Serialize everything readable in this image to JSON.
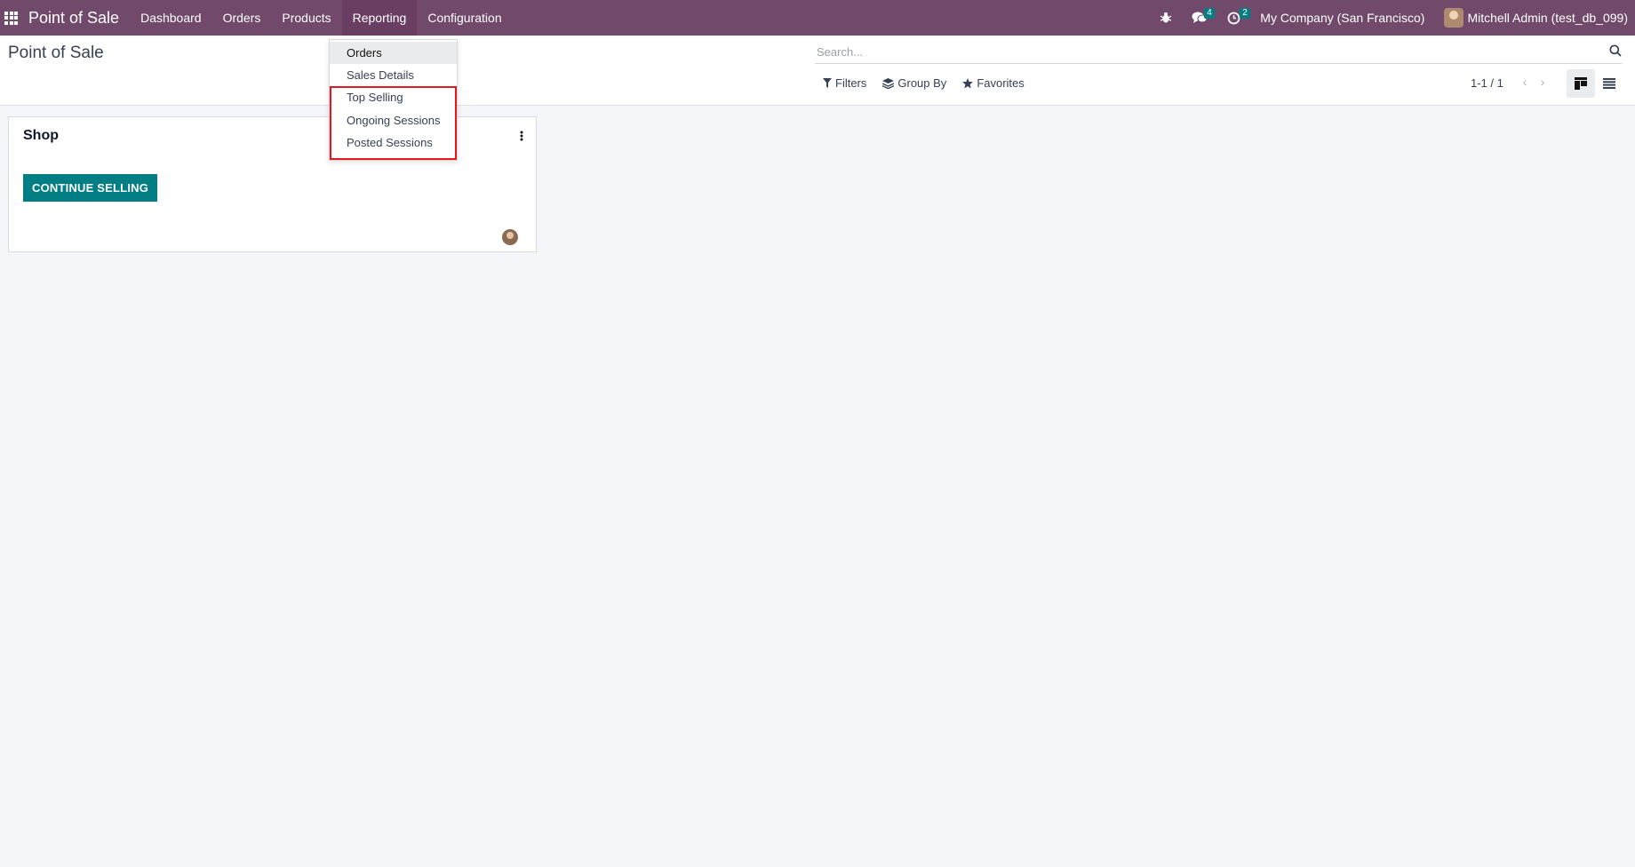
{
  "navbar": {
    "app_name": "Point of Sale",
    "menu": [
      {
        "label": "Dashboard"
      },
      {
        "label": "Orders"
      },
      {
        "label": "Products"
      },
      {
        "label": "Reporting"
      },
      {
        "label": "Configuration"
      }
    ],
    "messages_count": "4",
    "activities_count": "2",
    "company": "My Company (San Francisco)",
    "user": "Mitchell Admin (test_db_099)",
    "colors": {
      "navbar_bg": "#71496a",
      "badge_bg": "#017e84"
    }
  },
  "control_panel": {
    "title": "Point of Sale",
    "search_placeholder": "Search...",
    "filters_label": "Filters",
    "group_by_label": "Group By",
    "favorites_label": "Favorites",
    "pager": "1-1 / 1"
  },
  "reporting_menu": {
    "items": [
      {
        "label": "Orders"
      },
      {
        "label": "Sales Details"
      },
      {
        "label": "Top Selling"
      },
      {
        "label": "Ongoing Sessions"
      },
      {
        "label": "Posted Sessions"
      }
    ],
    "highlight_color": "#e5181b"
  },
  "kanban": {
    "cards": [
      {
        "title": "Shop",
        "button_label": "CONTINUE SELLING",
        "button_color": "#017e84"
      }
    ]
  }
}
